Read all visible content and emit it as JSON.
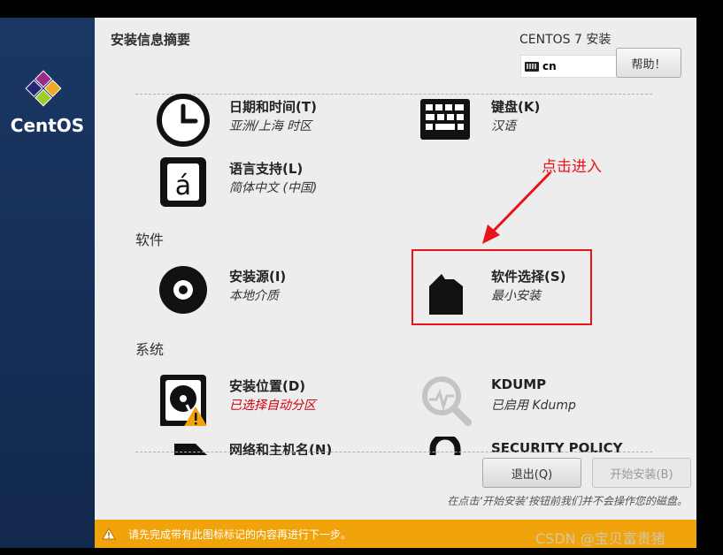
{
  "sidebar": {
    "brand": "CentOS"
  },
  "header": {
    "title": "安装信息摘要",
    "product": "CENTOS 7 安装",
    "keyboard_layout": "cn",
    "help_label": "帮助！"
  },
  "sections": {
    "software": "软件",
    "system": "系统"
  },
  "spokes": {
    "datetime": {
      "name": "日期和时间(T)",
      "status": "亚洲/上海 时区"
    },
    "keyboard": {
      "name": "键盘(K)",
      "status": "汉语"
    },
    "language": {
      "name": "语言支持(L)",
      "status": "简体中文 (中国)"
    },
    "source": {
      "name": "安装源(I)",
      "status": "本地介质"
    },
    "software": {
      "name": "软件选择(S)",
      "status": "最小安装"
    },
    "destination": {
      "name": "安装位置(D)",
      "status": "已选择自动分区"
    },
    "kdump": {
      "name": "KDUMP",
      "status": "已启用 Kdump"
    },
    "network": {
      "name": "网络和主机名(N)"
    },
    "security": {
      "name": "SECURITY POLICY"
    }
  },
  "annotation": "点击进入",
  "footer": {
    "quit_label": "退出(Q)",
    "begin_label": "开始安装(B)",
    "note": "在点击‘开始安装’按钮前我们并不会操作您的磁盘。"
  },
  "warning_bar": {
    "text": "请先完成带有此图标标记的内容再进行下一步。"
  },
  "watermark": "CSDN @宝贝富贵猪",
  "colors": {
    "accent": "#e8141a",
    "warning": "#f0a30a",
    "sidebar": "#1a3764"
  }
}
